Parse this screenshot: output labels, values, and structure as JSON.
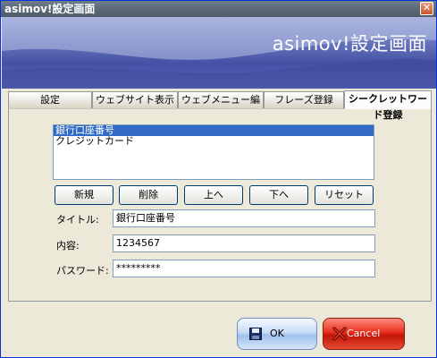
{
  "window": {
    "title": "asimov!設定画面",
    "close_glyph": "✕"
  },
  "banner": {
    "title": "asimov!設定画面"
  },
  "tabs": [
    {
      "label": "設定"
    },
    {
      "label": "ウェブサイト表示順"
    },
    {
      "label": "ウェブメニュー編集"
    },
    {
      "label": "フレーズ登録"
    },
    {
      "label": "シークレットワード登録",
      "active": true
    }
  ],
  "list": {
    "items": [
      "銀行口座番号",
      "クレジットカード"
    ],
    "selected": 0
  },
  "buttons": {
    "new": "新規",
    "delete": "削除",
    "up": "上へ",
    "down": "下へ",
    "reset": "リセット"
  },
  "form": {
    "title_label": "タイトル:",
    "title_value": "銀行口座番号",
    "content_label": "内容:",
    "content_value": "1234567",
    "password_label": "パスワード:",
    "password_value": "*********"
  },
  "footer": {
    "ok_label": "OK",
    "cancel_label": "Cancel"
  },
  "colors": {
    "titlebar": "#5d6b79",
    "selection": "#316ac5",
    "ok": "#9fc0ee",
    "cancel": "#c11608"
  }
}
